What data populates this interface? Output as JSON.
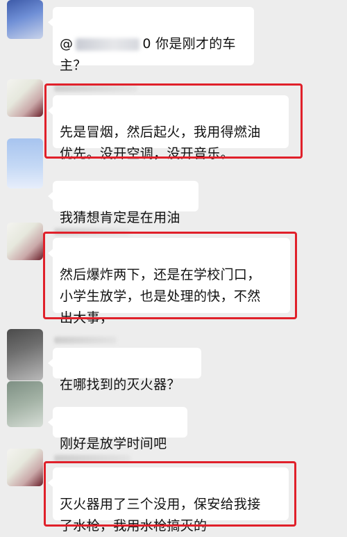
{
  "messages": [
    {
      "id": "m1",
      "text_prefix": "@",
      "text_after_mention": "0 你是刚才的车\n主？",
      "highlighted": false
    },
    {
      "id": "m2",
      "text": "先是冒烟，然后起火，我用得燃油\n优先。没开空调，没开音乐。",
      "highlighted": true
    },
    {
      "id": "m3",
      "text": "我猜想肯定是在用油",
      "highlighted": false
    },
    {
      "id": "m4",
      "text": "然后爆炸两下，还是在学校门口，\n小学生放学，也是处理的快，不然\n出大事，",
      "highlighted": true
    },
    {
      "id": "m5",
      "text": "在哪找到的灭火器？",
      "highlighted": false
    },
    {
      "id": "m6",
      "text": "刚好是放学时间吧",
      "highlighted": false
    },
    {
      "id": "m7",
      "text": "灭火器用了三个没用，保安给我接\n了水枪，我用水枪搞灭的",
      "highlighted": true
    }
  ],
  "colors": {
    "background": "#ededed",
    "bubble": "#ffffff",
    "highlight_border": "#e0202a",
    "text": "#111111"
  }
}
